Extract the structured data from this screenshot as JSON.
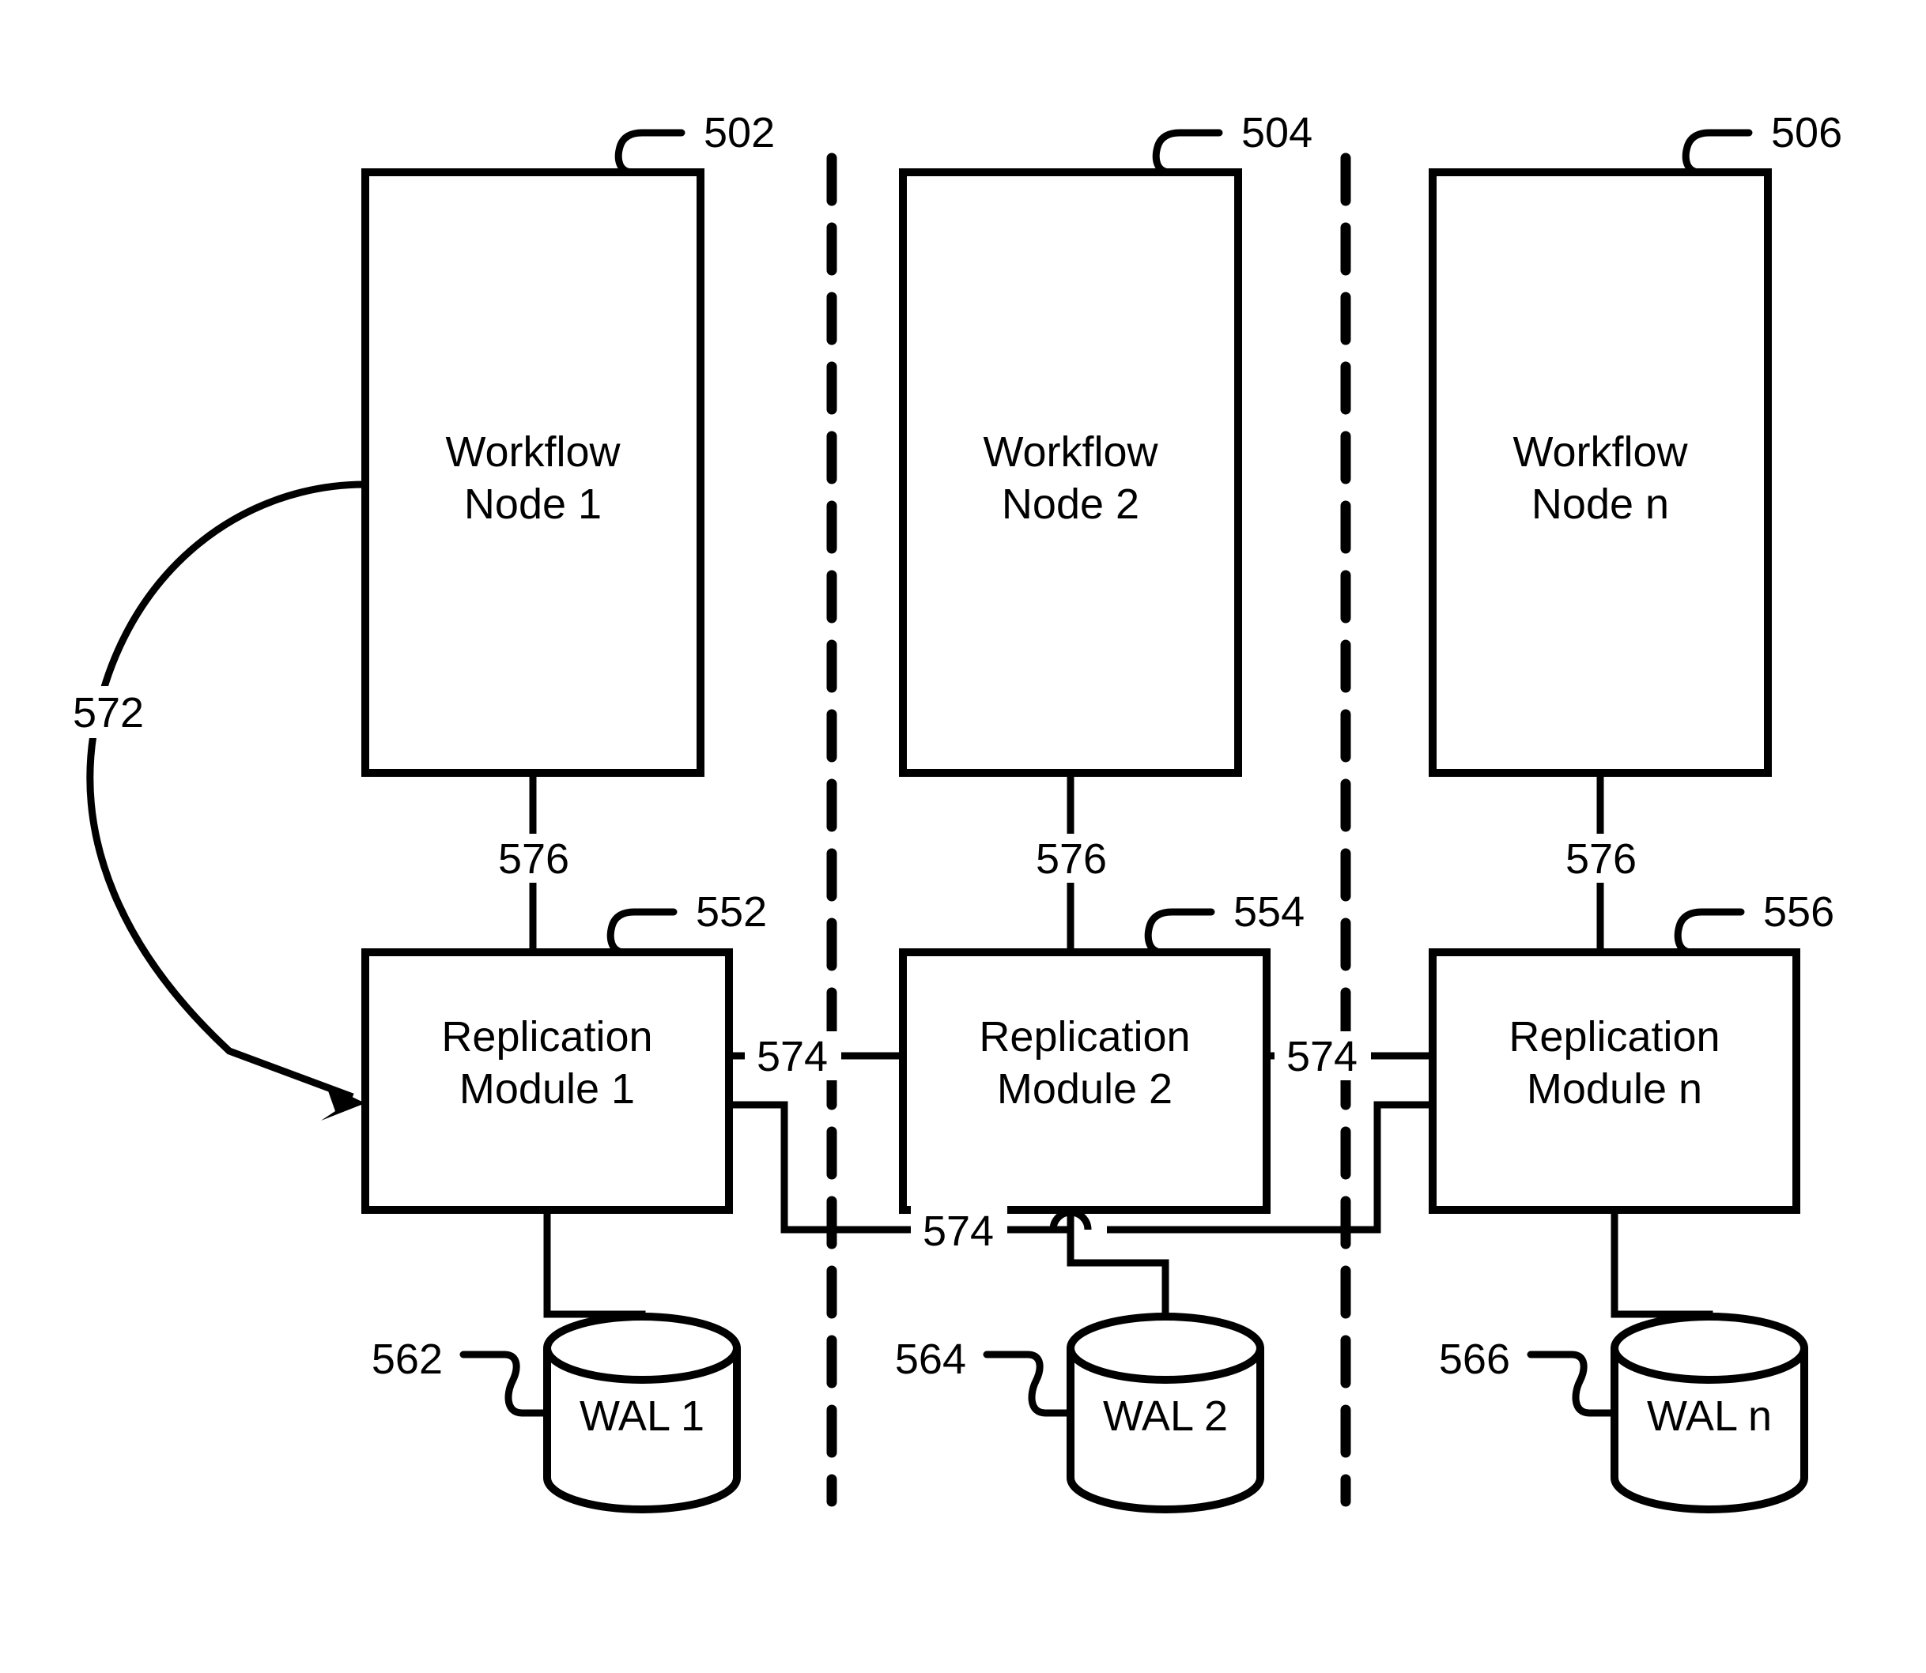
{
  "figure": {
    "type": "patent-block-diagram",
    "background": "#ffffff",
    "line_color": "#000000"
  },
  "columns": [
    {
      "node": {
        "ref": "502",
        "line1": "Workflow",
        "line2": "Node 1"
      },
      "module": {
        "ref": "552",
        "line1": "Replication",
        "line2": "Module 1"
      },
      "store": {
        "ref": "562",
        "label": "WAL 1"
      },
      "link_node_to_module": "576"
    },
    {
      "node": {
        "ref": "504",
        "line1": "Workflow",
        "line2": "Node 2"
      },
      "module": {
        "ref": "554",
        "line1": "Replication",
        "line2": "Module 2"
      },
      "store": {
        "ref": "564",
        "label": "WAL 2"
      },
      "link_node_to_module": "576"
    },
    {
      "node": {
        "ref": "506",
        "line1": "Workflow",
        "line2": "Node n"
      },
      "module": {
        "ref": "556",
        "line1": "Replication",
        "line2": "Module n"
      },
      "store": {
        "ref": "566",
        "label": "WAL n"
      },
      "link_node_to_module": "576"
    }
  ],
  "inbound_arrow": {
    "ref": "572"
  },
  "inter_module_links": [
    {
      "ref": "574"
    },
    {
      "ref": "574"
    },
    {
      "ref": "574"
    },
    {
      "ref": "574"
    }
  ]
}
